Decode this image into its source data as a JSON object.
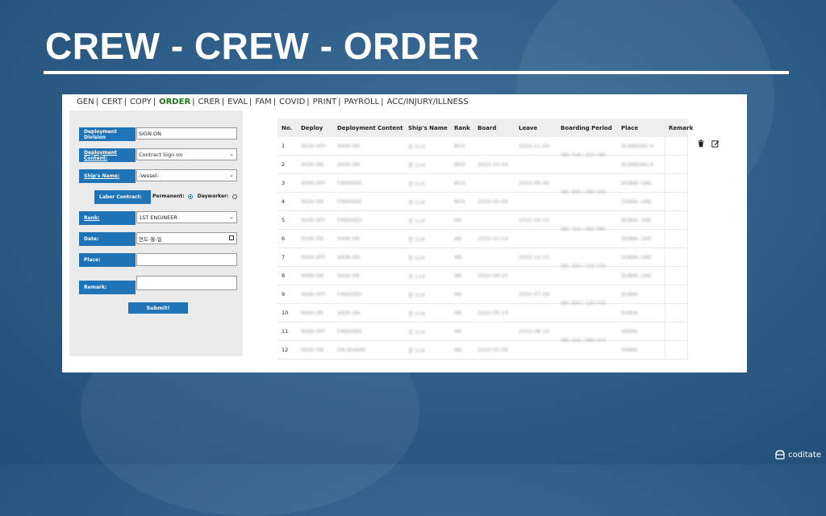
{
  "slide": {
    "title": "CREW - CREW - ORDER"
  },
  "nav": [
    "GEN",
    "CERT",
    "COPY",
    "ORDER",
    "CRER",
    "EVAL",
    "FAM",
    "COVID",
    "PRINT",
    "PAYROLL",
    "ACC/INJURY/ILLNESS"
  ],
  "nav_active": "ORDER",
  "form": {
    "deployment_division_label": "Deployment Division",
    "deployment_division_value": "SIGN ON",
    "deployment_content_label": "Deployment Content:",
    "deployment_content_value": "Contract Sign on",
    "ships_name_label": "Ship's Name:",
    "ships_name_value": "-Vessel-",
    "labor_contract_label": "Labor Contract:",
    "permanent_label": "Permanent:",
    "dayworker_label": "Dayworker:",
    "rank_label": "Rank:",
    "rank_value": "1ST ENGINEER",
    "date_label": "Date:",
    "date_placeholder": "연도-월-일",
    "place_label": "Place:",
    "remark_label": "Remark:",
    "submit_label": "Submit!"
  },
  "table": {
    "headers": [
      "No.",
      "Deploy",
      "Deployment Content",
      "Ship's Name",
      "Rank",
      "Board",
      "Leave",
      "Boarding Period",
      "Place",
      "Remark"
    ],
    "rows": [
      {
        "no": "1",
        "deploy": "SIGN OFF",
        "content": "SIGN ON",
        "ship": "전 114",
        "rank": "BOS",
        "board": "",
        "leave": "2022-11-28",
        "period": "",
        "place": "SCANDIAS A"
      },
      {
        "no": "2",
        "deploy": "SIGN ON",
        "content": "SIGN ON",
        "ship": "전 114",
        "rank": "BOS",
        "board": "2023-10-04",
        "leave": "",
        "period": "",
        "place": "SCANDIAS A"
      },
      {
        "no": "3",
        "deploy": "SIGN OFF",
        "content": "FINISHED",
        "ship": "전 114",
        "rank": "BOS",
        "board": "",
        "leave": "2022-06-48",
        "period": "",
        "place": "DUBAI, UAE"
      },
      {
        "no": "4",
        "deploy": "SIGN ON",
        "content": "FINISHED",
        "ship": "전 114",
        "rank": "BOS",
        "board": "2022-05-06",
        "leave": "",
        "period": "",
        "place": "DUBAI, UAE"
      },
      {
        "no": "5",
        "deploy": "SIGN OFF",
        "content": "FINISHED",
        "ship": "전 114",
        "rank": "AB",
        "board": "",
        "leave": "2022-04-15",
        "period": "",
        "place": "DUBAI, UAE"
      },
      {
        "no": "6",
        "deploy": "SIGN ON",
        "content": "SIGN ON",
        "ship": "전 114",
        "rank": "AB",
        "board": "2022-01-14",
        "leave": "",
        "period": "",
        "place": "DUBAI, UAE"
      },
      {
        "no": "7",
        "deploy": "SIGN OFF",
        "content": "SIGN ON",
        "ship": "전 114",
        "rank": "AB",
        "board": "",
        "leave": "2022-11-15",
        "period": "",
        "place": "DUBAI, UAE"
      },
      {
        "no": "8",
        "deploy": "SIGN ON",
        "content": "SIGN ON",
        "ship": "전 114",
        "rank": "AB",
        "board": "2022-06-20",
        "leave": "",
        "period": "",
        "place": "DUBAI, UAE"
      },
      {
        "no": "9",
        "deploy": "SIGN OFF",
        "content": "FINISHED",
        "ship": "전 114",
        "rank": "AB",
        "board": "",
        "leave": "2022-07-28",
        "period": "",
        "place": "DUBAI"
      },
      {
        "no": "10",
        "deploy": "SIGN ON",
        "content": "SIGN ON",
        "ship": "전 114",
        "rank": "AB",
        "board": "2022-05-14",
        "leave": "",
        "period": "",
        "place": "DUBAI"
      },
      {
        "no": "11",
        "deploy": "SIGN OFF",
        "content": "FINISHED",
        "ship": "전 114",
        "rank": "AB",
        "board": "",
        "leave": "2022-08-14",
        "period": "",
        "place": "OMAN"
      },
      {
        "no": "12",
        "deploy": "SIGN ON",
        "content": "ON BOARD",
        "ship": "전 114",
        "rank": "AB",
        "board": "2022-02-08",
        "leave": "",
        "period": "",
        "place": "OMAN"
      }
    ],
    "periods": [
      "081 518 / 202 (38)",
      "081 604 / 285 (20)",
      "081 024 / 065 (96)",
      "081 024 / 125 (73)",
      "081 024 / 125 (73)",
      "081 024 / 085 (47)"
    ]
  },
  "brand": {
    "name": "coditate"
  },
  "colors": {
    "accent": "#1f73b7",
    "active_nav": "#1a7a1a"
  }
}
